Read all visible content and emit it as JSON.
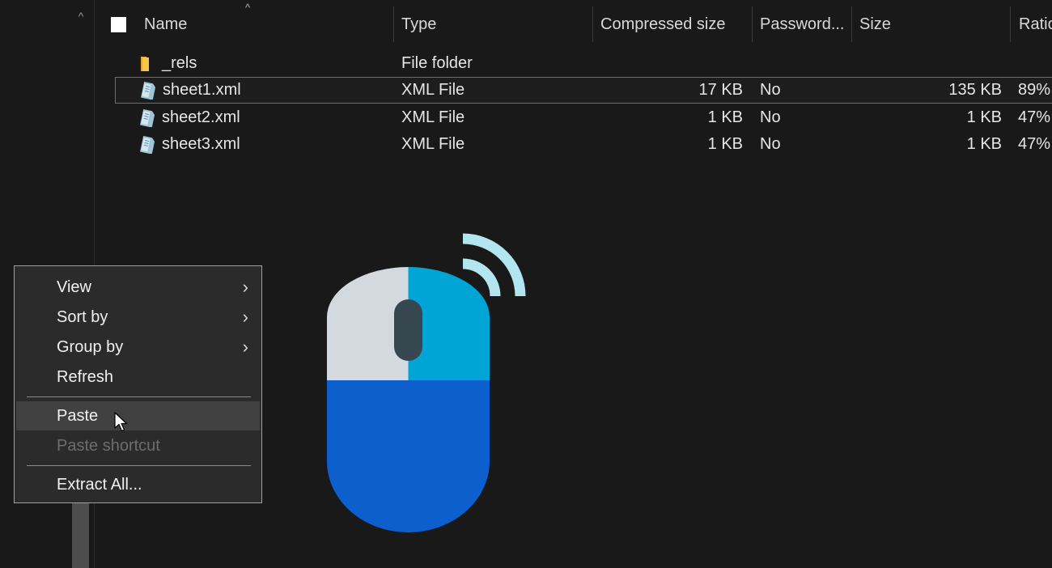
{
  "nav": {
    "scroll_up_icon": "chevron-up-icon"
  },
  "columns": {
    "name": "Name",
    "type": "Type",
    "compressed_size": "Compressed size",
    "password": "Password...",
    "size": "Size",
    "ratio": "Ratio"
  },
  "files": [
    {
      "name": "_rels",
      "type": "File folder",
      "compressed": "",
      "password": "",
      "size": "",
      "ratio": "",
      "icon": "folder-icon"
    },
    {
      "name": "sheet1.xml",
      "type": "XML File",
      "compressed": "17 KB",
      "password": "No",
      "size": "135 KB",
      "ratio": "89%",
      "icon": "xml-file-icon"
    },
    {
      "name": "sheet2.xml",
      "type": "XML File",
      "compressed": "1 KB",
      "password": "No",
      "size": "1 KB",
      "ratio": "47%",
      "icon": "xml-file-icon"
    },
    {
      "name": "sheet3.xml",
      "type": "XML File",
      "compressed": "1 KB",
      "password": "No",
      "size": "1 KB",
      "ratio": "47%",
      "icon": "xml-file-icon"
    }
  ],
  "context_menu": {
    "view": "View",
    "sort_by": "Sort by",
    "group_by": "Group by",
    "refresh": "Refresh",
    "paste": "Paste",
    "paste_shortcut": "Paste shortcut",
    "extract_all": "Extract All..."
  },
  "colors": {
    "background": "#191919",
    "menu_background": "#2b2b2b",
    "menu_hover": "#414141",
    "mouse_left_button": "#d3d9de",
    "mouse_right_button": "#00a5d6",
    "mouse_body": "#0c5fcd",
    "mouse_wheel": "#37474f",
    "wireless_waves": "#b3e5f0",
    "folder": "#f5c64a"
  }
}
